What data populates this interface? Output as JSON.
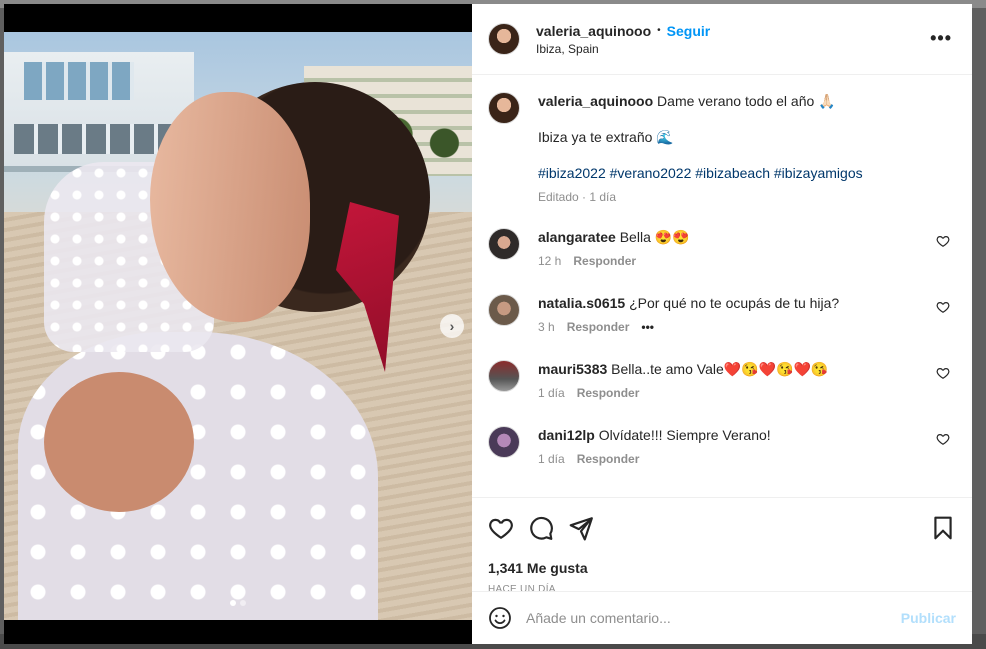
{
  "post": {
    "username": "valeria_aquinooo",
    "separator": "•",
    "follow_label": "Seguir",
    "location": "Ibiza, Spain",
    "more_label": "•••"
  },
  "caption": {
    "username": "valeria_aquinooo",
    "line1": "Dame verano todo el año 🙏🏻",
    "line2": "Ibiza ya te extraño 🌊",
    "hashtags": [
      "#ibiza2022",
      "#verano2022",
      "#ibizabeach",
      "#ibizayamigos"
    ],
    "meta": "Editado · 1 día"
  },
  "comments": [
    {
      "username": "alangaratee",
      "text": "Bella 😍😍",
      "time": "12 h",
      "reply": "Responder",
      "extra": ""
    },
    {
      "username": "natalia.s0615",
      "text": "¿Por qué no te ocupás de tu hija?",
      "time": "3 h",
      "reply": "Responder",
      "extra": "•••"
    },
    {
      "username": "mauri5383",
      "text": "Bella..te amo Vale❤️😘❤️😘❤️😘",
      "time": "1 día",
      "reply": "Responder",
      "extra": ""
    },
    {
      "username": "dani12lp",
      "text": "Olvídate!!! Siempre Verano!",
      "time": "1 día",
      "reply": "Responder",
      "extra": ""
    }
  ],
  "actions": {
    "likes": "1,341 Me gusta",
    "time": "HACE UN DÍA"
  },
  "add_comment": {
    "placeholder": "Añade un comentario...",
    "publish_label": "Publicar"
  },
  "media": {
    "next_arrow": "›",
    "slide_count": 2,
    "active_slide": 1
  },
  "colors": {
    "link": "#0095f6",
    "hashtag": "#00376b",
    "publish_disabled": "#b2dffc"
  }
}
